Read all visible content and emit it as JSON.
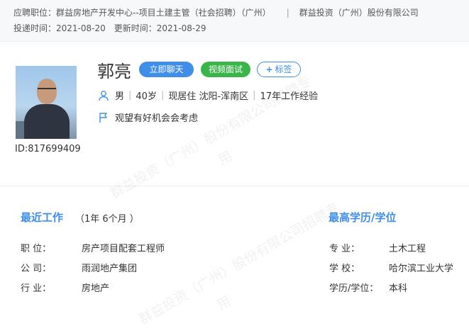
{
  "header": {
    "position_label": "应聘职位：",
    "position_value": "群益房地产开发中心--项目土建主管（社会招聘）（广州）",
    "separator": "|",
    "company": "群益投资（广州）股份有限公司",
    "apply_label": "投递时间：",
    "apply_date": "2021-08-20",
    "update_label": "更新时间：",
    "update_date": "2021-08-29"
  },
  "profile": {
    "name": "郭亮",
    "chat_label": "立即聊天",
    "video_label": "视频面试",
    "tag_plus": "+",
    "tag_label": "标签",
    "gender": "男",
    "age": "40岁",
    "residence": "现居住 沈阳-浑南区",
    "experience": "17年工作经验",
    "intent": "观望有好机会会考虑",
    "id_text": "ID:817699409",
    "sep": "|"
  },
  "work": {
    "title": "最近工作",
    "duration": "（1年 6个月 ）",
    "rows": [
      {
        "label": "职    位：",
        "value": "房产项目配套工程师"
      },
      {
        "label": "公    司：",
        "value": "雨润地产集团"
      },
      {
        "label": "行    业：",
        "value": "房地产"
      }
    ]
  },
  "education": {
    "title": "最高学历/学位",
    "rows": [
      {
        "label": "专    业：",
        "value": "土木工程"
      },
      {
        "label": "学    校：",
        "value": "哈尔滨工业大学"
      },
      {
        "label": "学历/学位：",
        "value": "本科"
      }
    ]
  },
  "watermark": {
    "line_a": "群益投资（广州）股份有限公司招聘专",
    "line_b": "用"
  },
  "colors": {
    "accent": "#3f8ee8",
    "video": "#39b54a"
  },
  "icons": {
    "person": "person-icon",
    "flag": "flag-icon"
  }
}
